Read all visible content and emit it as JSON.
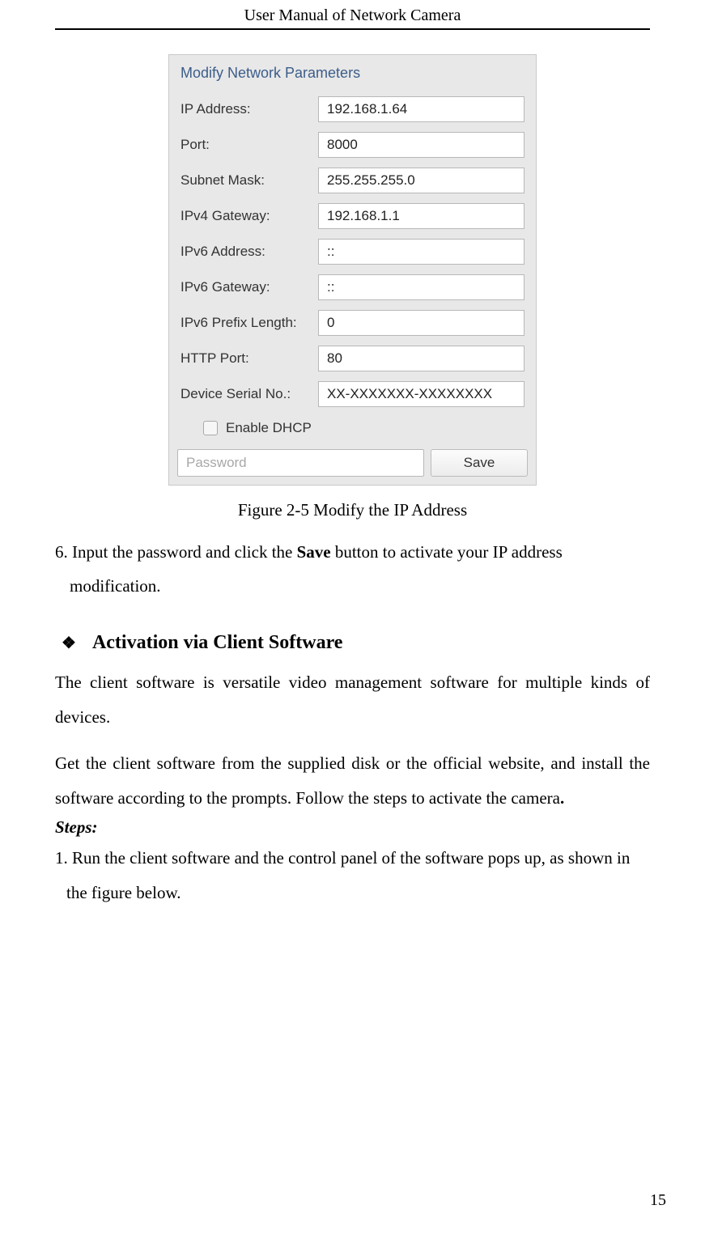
{
  "header": {
    "title": "User Manual of Network Camera"
  },
  "dialog": {
    "title": "Modify Network Parameters",
    "rows": {
      "ip_address": {
        "label": "IP Address:",
        "value": "192.168.1.64"
      },
      "port": {
        "label": "Port:",
        "value": "8000"
      },
      "subnet_mask": {
        "label": "Subnet Mask:",
        "value": "255.255.255.0"
      },
      "ipv4_gateway": {
        "label": "IPv4 Gateway:",
        "value": "192.168.1.1"
      },
      "ipv6_address": {
        "label": "IPv6 Address:",
        "value": "::"
      },
      "ipv6_gateway": {
        "label": "IPv6 Gateway:",
        "value": "::"
      },
      "ipv6_prefix": {
        "label": "IPv6 Prefix Length:",
        "value": "0"
      },
      "http_port": {
        "label": "HTTP Port:",
        "value": "80"
      },
      "serial": {
        "label": "Device Serial No.:",
        "value": "XX-XXXXXXX-XXXXXXXX"
      }
    },
    "dhcp_label": "Enable DHCP",
    "password_placeholder": "Password",
    "save_label": "Save"
  },
  "figure_caption": "Figure 2-5 Modify the IP Address",
  "step6": {
    "prefix": "6. Input the password and click the ",
    "bold": "Save",
    "suffix": " button to activate your IP address",
    "line2": "modification."
  },
  "section_heading": "Activation via Client Software",
  "para1": "The client software is versatile video management software for multiple kinds of devices.",
  "para2_a": "Get the client software from the supplied disk or the official website, and install the software according to the prompts. Follow the steps to activate the camera",
  "para2_period": ".",
  "steps_label": "Steps:",
  "step1": {
    "line1": "1. Run the client software and the control panel of the software pops up, as shown in",
    "line2": "the figure below."
  },
  "page_number": "15"
}
